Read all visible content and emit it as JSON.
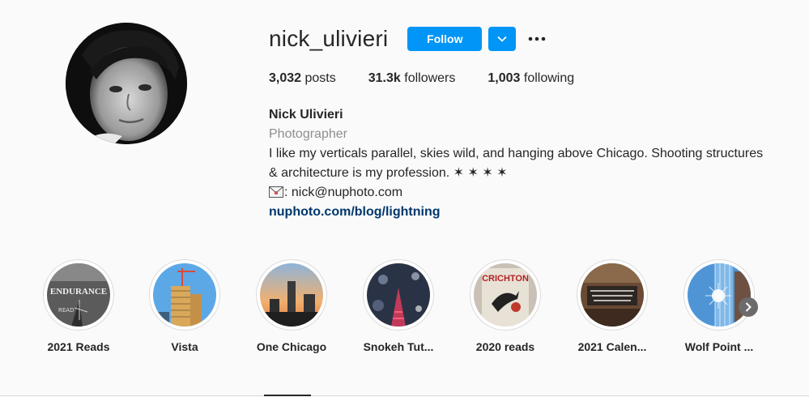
{
  "profile": {
    "username": "nick_ulivieri",
    "follow_label": "Follow",
    "dropdown_icon": "chevron-down-icon",
    "more_icon": "ellipsis-icon"
  },
  "stats": {
    "posts_count": "3,032",
    "posts_label": "posts",
    "followers_count": "31.3k",
    "followers_label": "followers",
    "following_count": "1,003",
    "following_label": "following"
  },
  "bio": {
    "name": "Nick Ulivieri",
    "category": "Photographer",
    "text_line1": "I like my verticals parallel, skies wild, and hanging above Chicago. Shooting structures",
    "text_line2": "& architecture is my profession. ✶ ✶ ✶ ✶",
    "email_text": ": nick@nuphoto.com",
    "link": "nuphoto.com/blog/lightning"
  },
  "highlights": [
    {
      "label": "2021 Reads"
    },
    {
      "label": "Vista"
    },
    {
      "label": "One Chicago"
    },
    {
      "label": "Snokeh Tut..."
    },
    {
      "label": "2020 reads"
    },
    {
      "label": "2021 Calen..."
    },
    {
      "label": "Wolf Point ..."
    }
  ],
  "highlight_art": {
    "h0_title": "ENDURANCE",
    "h4_title": "CRICHTON"
  },
  "colors": {
    "follow_button": "#0095f6",
    "link": "#00376b",
    "secondary_text": "#8e8e8e",
    "background": "#fafafa"
  }
}
